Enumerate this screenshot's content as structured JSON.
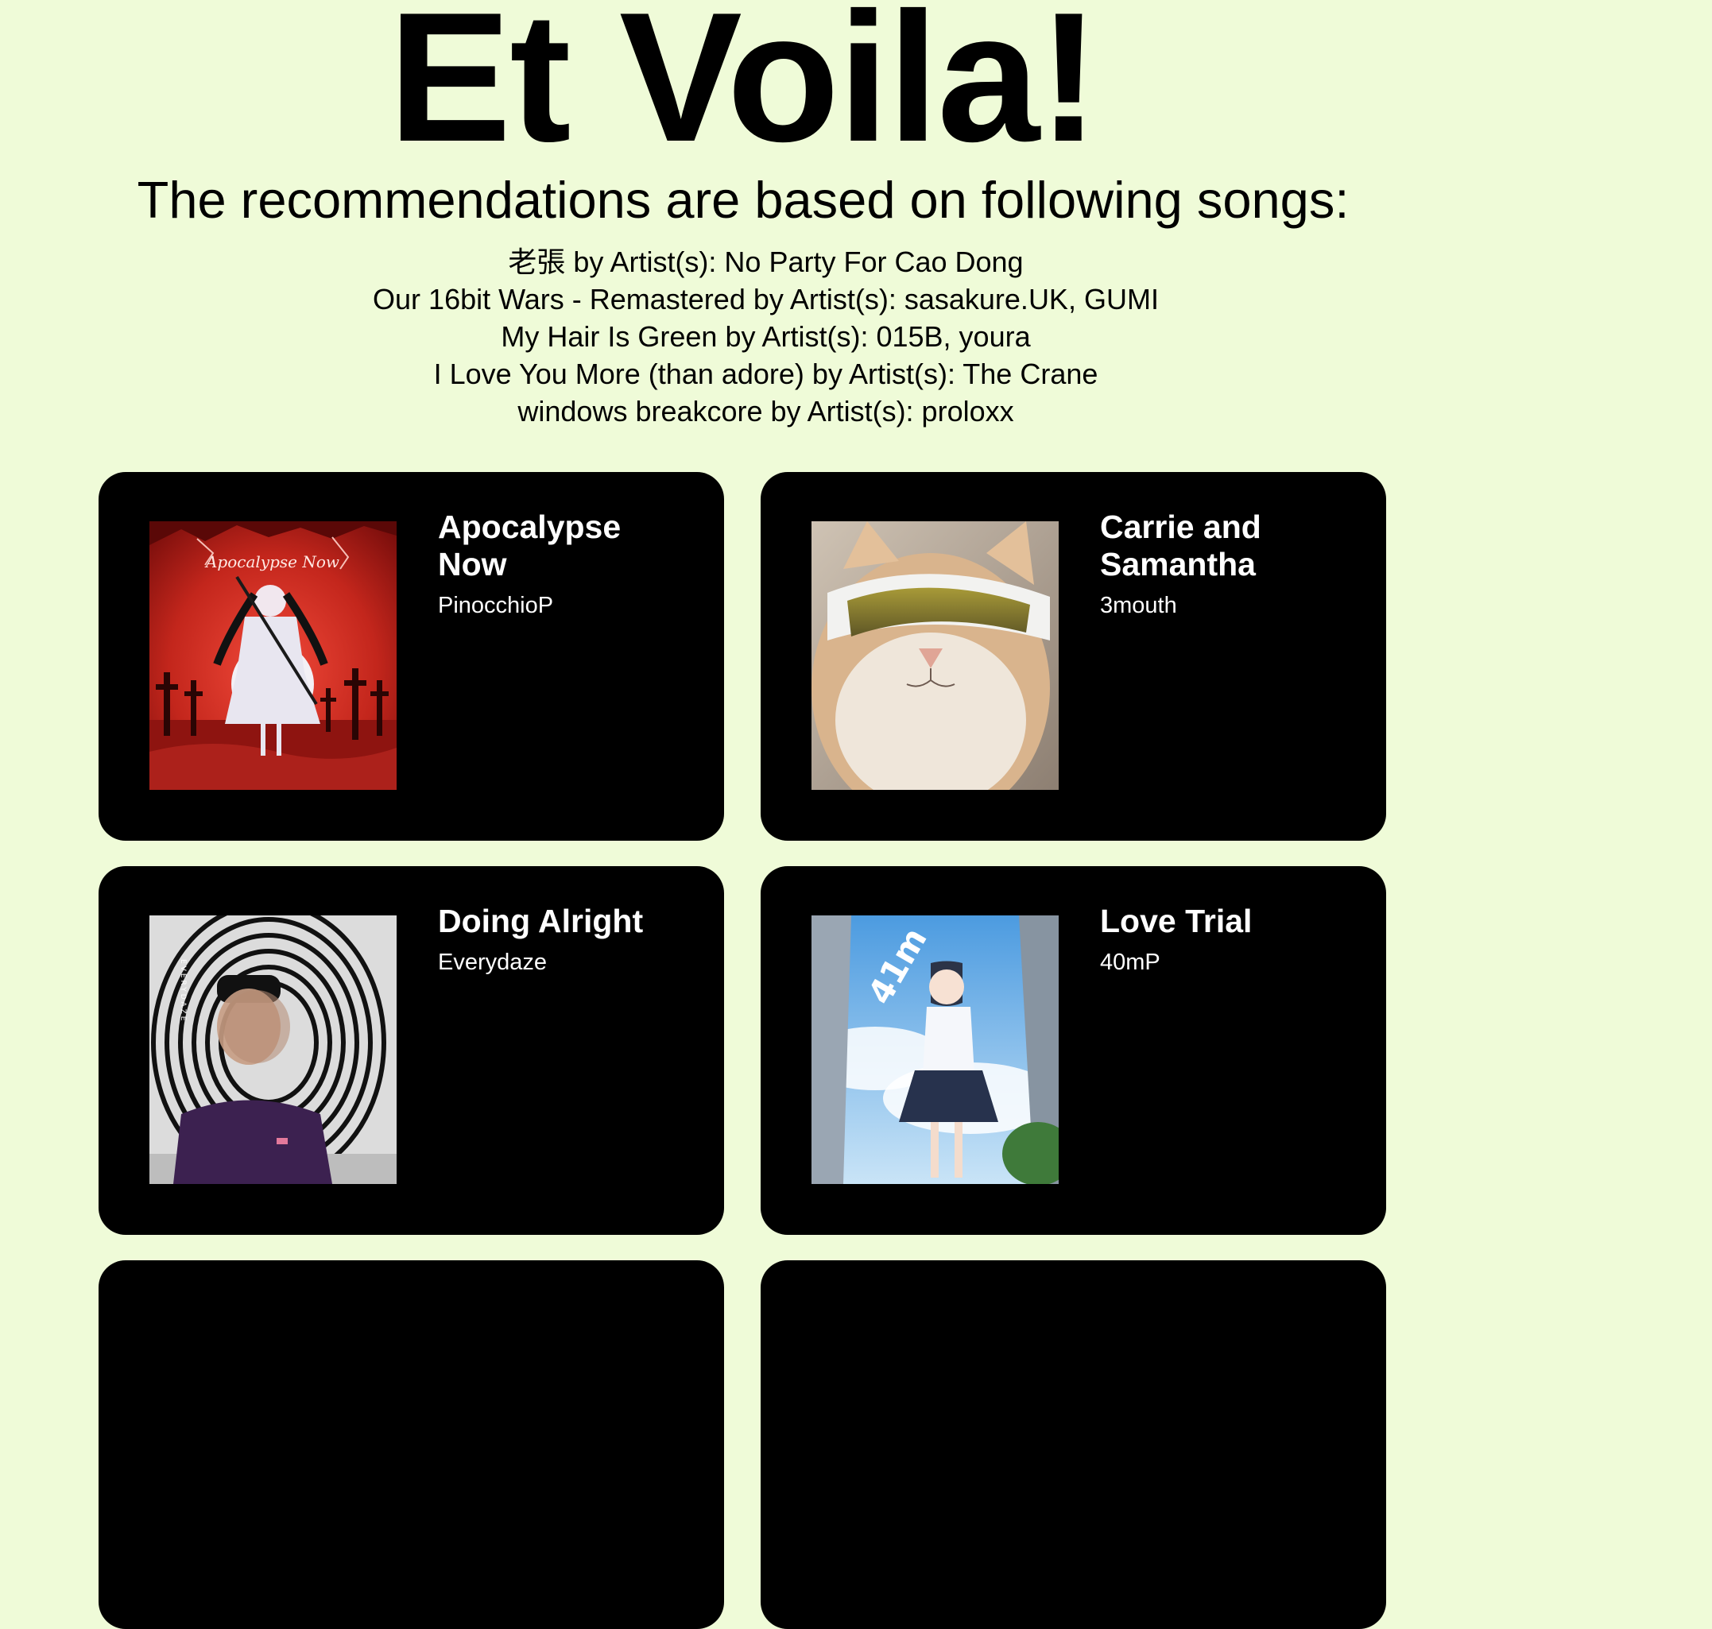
{
  "header": {
    "title": "Et Voila!",
    "subtitle": "The recommendations are based on following songs:"
  },
  "seed_songs": [
    "老張 by Artist(s): No Party For Cao Dong",
    "Our 16bit Wars - Remastered by Artist(s): sasakure.UK, GUMI",
    "My Hair Is Green by Artist(s): 015B, youra",
    "I Love You More (than adore) by Artist(s): The Crane",
    "windows breakcore by Artist(s): proloxx"
  ],
  "recommendations": [
    {
      "title": "Apocalypse Now",
      "artist": "PinocchioP",
      "cover": "apocalypse-now-cover",
      "cover_text": "Apocalypse Now"
    },
    {
      "title": "Carrie and Samantha",
      "artist": "3mouth",
      "cover": "cat-with-visor-cover"
    },
    {
      "title": "Doing Alright",
      "artist": "Everydaze",
      "cover": "spiral-portrait-cover",
      "cover_text": "EVERYDAZE"
    },
    {
      "title": "Love Trial",
      "artist": "40mP",
      "cover": "anime-girl-sky-cover",
      "cover_text": "41m"
    },
    {
      "title": "",
      "artist": ""
    },
    {
      "title": "",
      "artist": ""
    }
  ],
  "colors": {
    "background": "#effbd8",
    "card": "#000000",
    "card_text": "#ffffff"
  }
}
